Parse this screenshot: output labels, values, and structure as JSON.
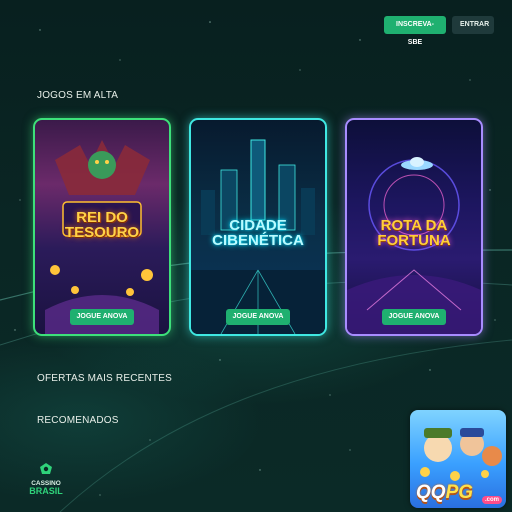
{
  "header": {
    "signup_label": "INSCREVA-SBE",
    "login_label": "ENTRAR"
  },
  "sections": {
    "trending_title": "JOGOS EM ALTA",
    "offers_title": "OFERTAS MAIS RECENTES",
    "recommended_title": "RECOMENADOS"
  },
  "games": [
    {
      "title_line1": "REI DO",
      "title_line2": "TESOURO",
      "play_label": "JOGUE ANOVA",
      "accent": "#3de07a"
    },
    {
      "title_line1": "CIDADE",
      "title_line2": "CIBENÉTICA",
      "play_label": "JOGUE ANOVA",
      "accent": "#3fe8e2"
    },
    {
      "title_line1": "ROTA DA",
      "title_line2": "FORTUNA",
      "play_label": "JOGUE ANOVA",
      "accent": "#a88cff"
    }
  ],
  "brand": {
    "line1": "CASSINO",
    "line2": "BRASIL",
    "color": "#2fd27a"
  },
  "promo": {
    "logo_part1": "QQ",
    "logo_part2": "PG",
    "domain_badge": ".com"
  },
  "colors": {
    "primary_button": "#1fb070",
    "background": "#0a2624"
  }
}
